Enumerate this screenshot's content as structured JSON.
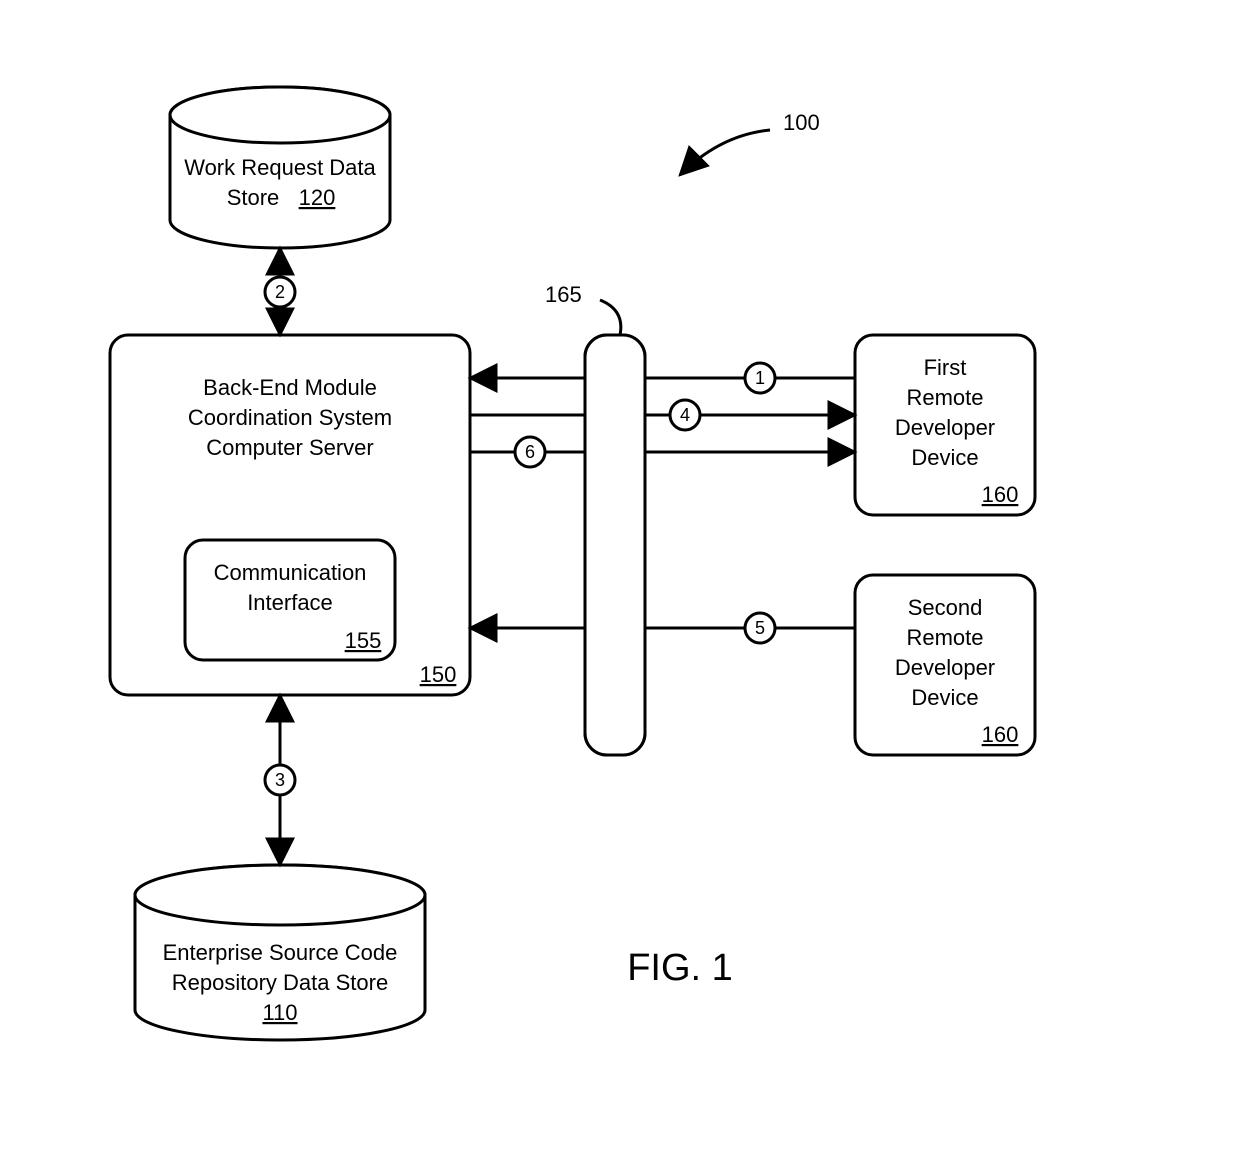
{
  "figure_label": "FIG. 1",
  "ref_100": "100",
  "ref_165": "165",
  "db_top": {
    "line1": "Work Request Data",
    "line2": "Store",
    "ref": "120"
  },
  "db_bottom": {
    "line1": "Enterprise Source Code",
    "line2": "Repository Data Store",
    "ref": "110"
  },
  "server": {
    "line1": "Back-End Module",
    "line2": "Coordination System",
    "line3": "Computer Server",
    "ref": "150"
  },
  "comm": {
    "line1": "Communication",
    "line2": "Interface",
    "ref": "155"
  },
  "dev1": {
    "line1": "First",
    "line2": "Remote",
    "line3": "Developer",
    "line4": "Device",
    "ref": "160"
  },
  "dev2": {
    "line1": "Second",
    "line2": "Remote",
    "line3": "Developer",
    "line4": "Device",
    "ref": "160"
  },
  "steps": {
    "s1": "1",
    "s2": "2",
    "s3": "3",
    "s4": "4",
    "s5": "5",
    "s6": "6"
  }
}
